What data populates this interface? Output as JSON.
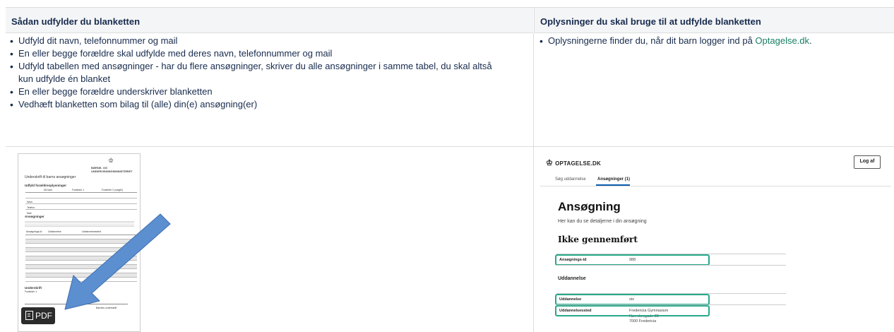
{
  "table": {
    "header_left": "Sådan udfylder du blanketten",
    "header_right": "Oplysninger du skal bruge til at udfylde blanketten",
    "left_bullets": [
      "Udfyld dit navn, telefonnummer og mail",
      "En eller begge forældre skal udfylde med deres navn, telefonnummer og mail",
      "Udfyld tabellen med ansøgninger - har du flere ansøgninger, skriver du alle ansøgninger i samme tabel, du skal altså kun udfylde én blanket",
      "En eller begge forældre underskriver blanketten",
      "Vedhæft blanketten som bilag til (alle) din(e) ansøgning(er)"
    ],
    "right_bullet_prefix": "Oplysningerne finder du, når dit barn logger ind på ",
    "right_bullet_link": "Optagelse.dk",
    "right_bullet_suffix": "."
  },
  "pdf": {
    "ministry": "BØRNE- OG\nUNDERVISNINGSMINISTERIET",
    "doc_title": "Underskrift til barns ansøgninger",
    "section1": "Udfyld forældreoplysninger",
    "col1": "Dit barn",
    "col2": "Forælder 1",
    "col3": "Forælder 2 (valgfri)",
    "row_labels": [
      "Navn",
      "Telefon",
      "Mail"
    ],
    "section2": "Ansøgninger",
    "table2_col1": "Ansøgnings-id",
    "table2_col2": "Uddannelse",
    "table2_col3": "Uddannelsessted",
    "section3": "Underskrift",
    "sig_label1": "Forælder 1",
    "sig_label2": "Barnets underskrift",
    "badge": "PDF"
  },
  "optagelse": {
    "logo": "OPTAGELSE.DK",
    "logout": "Log af",
    "nav_search": "Søg uddannelse",
    "nav_applications": "Ansøgninger (1)",
    "title": "Ansøgning",
    "subtitle": "Her kan du se detaljerne i din ansøgning",
    "status": "Ikke gennemført",
    "row1_key": "Ansøgnings-id",
    "row1_val": "988",
    "section": "Uddannelse",
    "row2_key": "Uddannelse",
    "row2_val": "stx",
    "row3_key": "Uddannelsessted",
    "row3_val1": "Fredericia Gymnasium",
    "row3_val2": "Nørrebrogade 88",
    "row3_val3": "7000 Fredericia"
  },
  "colors": {
    "link": "#1a7f64",
    "highlight": "#27a98a",
    "arrow": "#5b8fd0"
  }
}
